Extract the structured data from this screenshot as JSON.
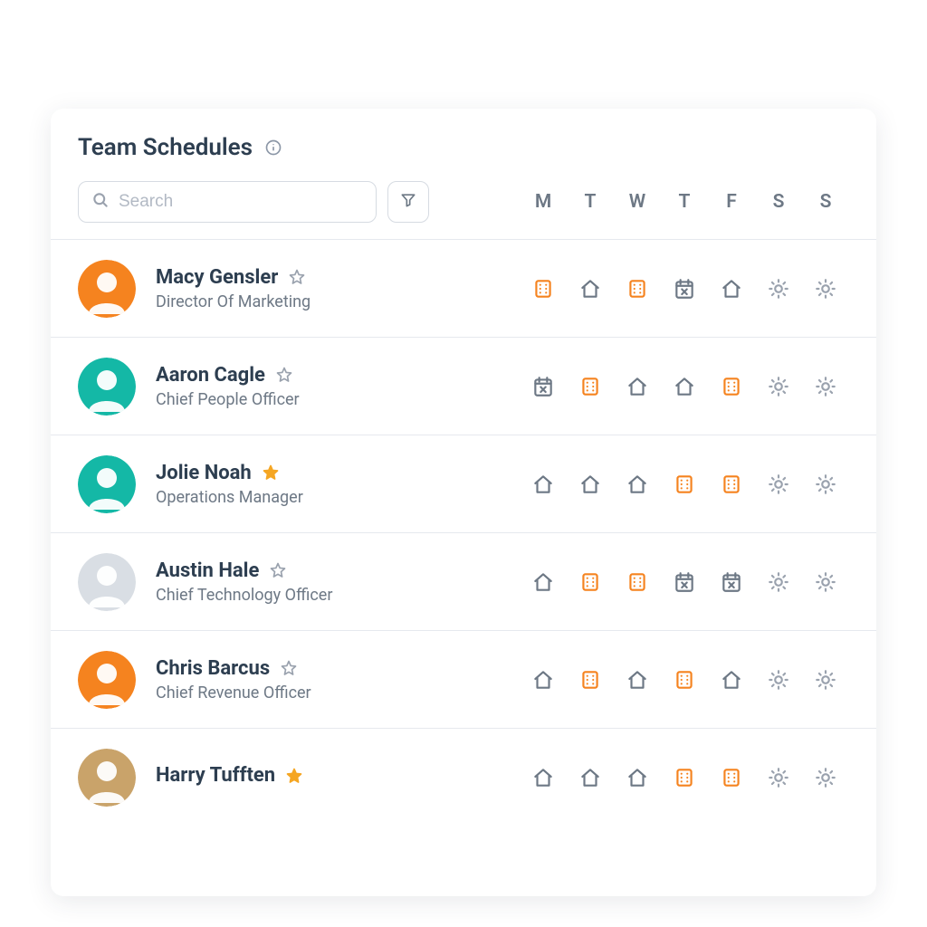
{
  "header": {
    "title": "Team Schedules",
    "search_placeholder": "Search"
  },
  "days": [
    "M",
    "T",
    "W",
    "T",
    "F",
    "S",
    "S"
  ],
  "people": [
    {
      "name": "Macy Gensler",
      "role": "Director Of Marketing",
      "favorite": false,
      "avatar_bg": "#f5831f",
      "schedule": [
        "office",
        "home",
        "office",
        "off",
        "home",
        "sun",
        "sun"
      ]
    },
    {
      "name": "Aaron Cagle",
      "role": "Chief People Officer",
      "favorite": false,
      "avatar_bg": "#14b8a6",
      "schedule": [
        "off",
        "office",
        "home",
        "home",
        "office",
        "sun",
        "sun"
      ]
    },
    {
      "name": "Jolie Noah",
      "role": "Operations Manager",
      "favorite": true,
      "avatar_bg": "#14b8a6",
      "schedule": [
        "home",
        "home",
        "home",
        "office",
        "office",
        "sun",
        "sun"
      ]
    },
    {
      "name": "Austin Hale",
      "role": "Chief Technology Officer",
      "favorite": false,
      "avatar_bg": "#d9dee4",
      "schedule": [
        "home",
        "office",
        "office",
        "off",
        "off",
        "sun",
        "sun"
      ]
    },
    {
      "name": "Chris Barcus",
      "role": "Chief Revenue Officer",
      "favorite": false,
      "avatar_bg": "#f5831f",
      "schedule": [
        "home",
        "office",
        "home",
        "office",
        "home",
        "sun",
        "sun"
      ]
    },
    {
      "name": "Harry Tufften",
      "role": "",
      "favorite": true,
      "avatar_bg": "#c9a36a",
      "schedule": [
        "home",
        "home",
        "home",
        "office",
        "office",
        "sun",
        "sun"
      ]
    }
  ],
  "colors": {
    "accent": "#f5831f",
    "muted": "#6d7885"
  }
}
